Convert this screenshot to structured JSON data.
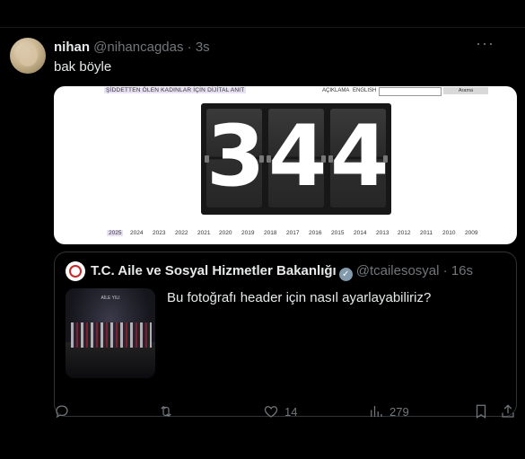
{
  "tweet": {
    "name": "nihan",
    "handle": "@nihancagdas",
    "time": "3s",
    "text": "bak böyle",
    "more_icon": "more-horizontal-icon"
  },
  "media": {
    "site_title": "ŞİDDETTEN ÖLEN KADINLAR İÇİN DİJİTAL ANIT",
    "nav": {
      "about": "AÇIKLAMA",
      "english": "ENGLISH",
      "search_button": "Arama"
    },
    "counter_digits": [
      "3",
      "4",
      "4"
    ],
    "years": [
      "2025",
      "2024",
      "2023",
      "2022",
      "2021",
      "2020",
      "2019",
      "2018",
      "2017",
      "2016",
      "2015",
      "2014",
      "2013",
      "2012",
      "2011",
      "2010",
      "2009"
    ],
    "selected_year": "2025"
  },
  "quote": {
    "name": "T.C. Aile ve Sosyal Hizmetler Bakanlığı",
    "handle": "@tcailesosyal",
    "time": "16s",
    "text": "Bu fotoğrafı header için nasıl ayarlayabiliriz?",
    "thumb_caption": "AİLE YILI"
  },
  "actions": {
    "reply_icon": "reply-icon",
    "retweet_icon": "retweet-icon",
    "like_icon": "heart-icon",
    "like_count": "14",
    "views_icon": "views-chart-icon",
    "views_count": "279",
    "bookmark_icon": "bookmark-icon",
    "share_icon": "share-icon"
  },
  "colors": {
    "background": "#000000",
    "text": "#e7e9ea",
    "muted": "#71767b",
    "border": "#2f3336"
  }
}
